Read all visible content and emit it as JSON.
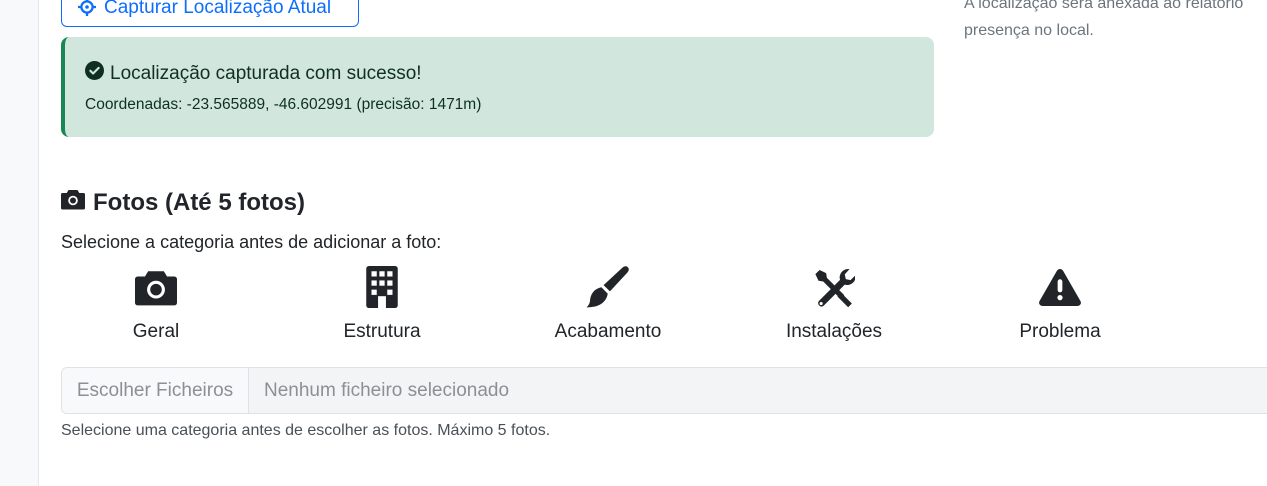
{
  "location": {
    "capture_button_label": "Capturar Localização Atual",
    "side_note": "A localização será anexada ao relatório presença no local."
  },
  "alert": {
    "title": "Localização capturada com sucesso!",
    "coords": "Coordenadas: -23.565889, -46.602991 (precisão: 1471m)",
    "status_color": "#198754"
  },
  "photos": {
    "title": "Fotos (Até 5 fotos)",
    "hint": "Selecione a categoria antes de adicionar a foto:",
    "categories": [
      {
        "label": "Geral",
        "icon": "camera-icon"
      },
      {
        "label": "Estrutura",
        "icon": "building-icon"
      },
      {
        "label": "Acabamento",
        "icon": "brush-icon"
      },
      {
        "label": "Instalações",
        "icon": "tools-icon"
      },
      {
        "label": "Problema",
        "icon": "warning-icon"
      }
    ],
    "file_button": "Escolher Ficheiros",
    "file_status": "Nenhum ficheiro selecionado",
    "help_text": "Selecione uma categoria antes de escolher as fotos. Máximo 5 fotos."
  }
}
